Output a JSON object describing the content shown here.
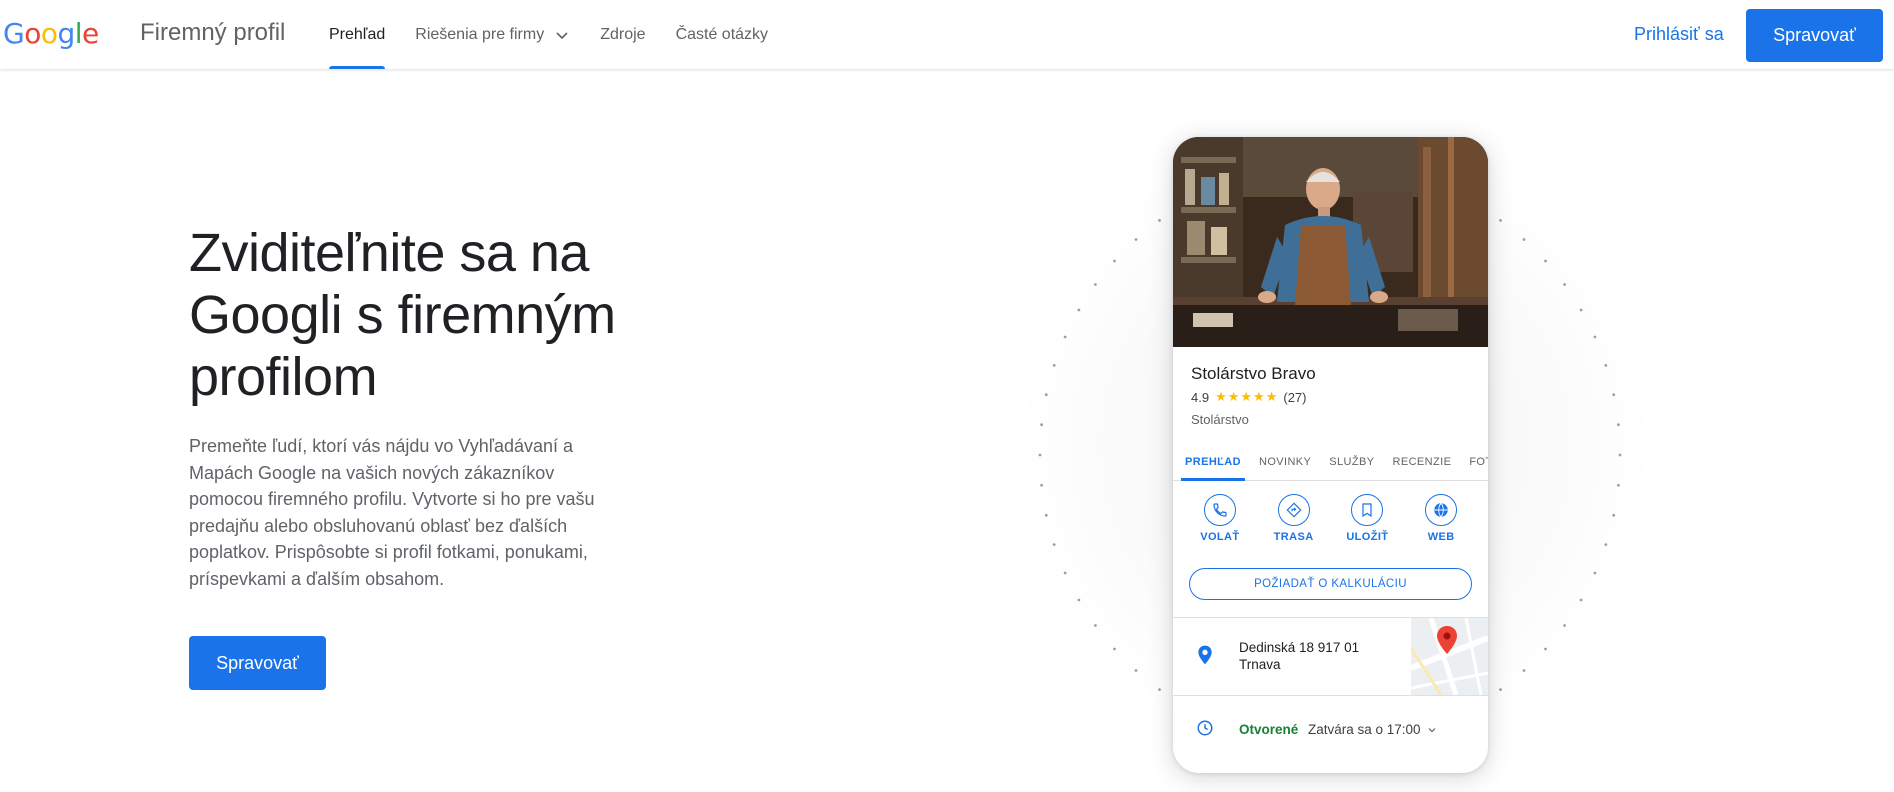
{
  "header": {
    "logo_letters": [
      {
        "char": "G",
        "color": "#4285F4"
      },
      {
        "char": "o",
        "color": "#EA4335"
      },
      {
        "char": "o",
        "color": "#FBBC05"
      },
      {
        "char": "g",
        "color": "#4285F4"
      },
      {
        "char": "l",
        "color": "#34A853"
      },
      {
        "char": "e",
        "color": "#EA4335"
      }
    ],
    "product_name": "Firemný profil",
    "nav": [
      {
        "label": "Prehľad",
        "active": true
      },
      {
        "label": "Riešenia pre firmy",
        "has_dropdown": true
      },
      {
        "label": "Zdroje"
      },
      {
        "label": "Časté otázky"
      }
    ],
    "signin_label": "Prihlásiť sa",
    "manage_label": "Spravovať"
  },
  "hero": {
    "title": "Zviditeľnite sa na Googli s firemným profilom",
    "description": "Premeňte ľudí, ktorí vás nájdu vo Vyhľadávaní a Mapách Google na vašich nových zákazníkov pomocou firemného profilu. Vytvorte si ho pre vašu predajňu alebo obsluhovanú oblasť bez ďalších poplatkov. Prispôsobte si profil fotkami, ponukami, príspevkami a ďalším obsahom.",
    "cta_label": "Spravovať"
  },
  "profile_card": {
    "business_name": "Stolárstvo Bravo",
    "rating": "4.9",
    "stars": "★★★★★",
    "review_count": "(27)",
    "category": "Stolárstvo",
    "tabs": [
      {
        "label": "PREHĽAD",
        "active": true
      },
      {
        "label": "NOVINKY"
      },
      {
        "label": "SLUŽBY"
      },
      {
        "label": "RECENZIE"
      },
      {
        "label": "FOTKY"
      }
    ],
    "actions": [
      {
        "label": "VOLAŤ",
        "icon": "phone-icon"
      },
      {
        "label": "TRASA",
        "icon": "directions-icon"
      },
      {
        "label": "ULOŽIŤ",
        "icon": "bookmark-icon"
      },
      {
        "label": "WEB",
        "icon": "globe-icon"
      }
    ],
    "quote_label": "POŽIADAŤ O KALKULÁCIU",
    "address_line1": "Dedinská 18 917 01",
    "address_line2": "Trnava",
    "open_status": "Otvorené",
    "closes_text": "Zatvára sa o 17:00"
  },
  "colors": {
    "accent": "#1a73e8",
    "open_green": "#188038",
    "star_yellow": "#fbbc04",
    "map_pin_red": "#ea4335"
  }
}
